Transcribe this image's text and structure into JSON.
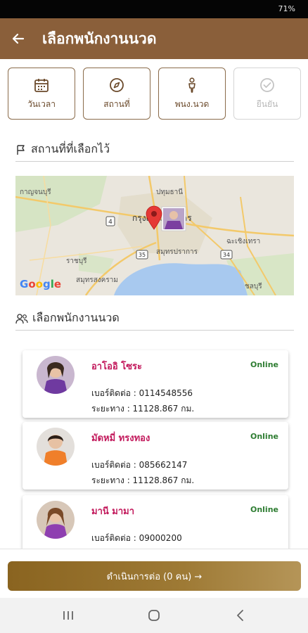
{
  "status_bar": {
    "battery": "71%"
  },
  "app_bar": {
    "title": "เลือกพนักงานนวด",
    "back_icon": "arrow-left-icon"
  },
  "steps": [
    {
      "label": "วันเวลา",
      "icon": "calendar-icon",
      "enabled": true
    },
    {
      "label": "สถานที่",
      "icon": "compass-icon",
      "enabled": true
    },
    {
      "label": "พนง.นวด",
      "icon": "person-icon",
      "enabled": true
    },
    {
      "label": "ยืนยัน",
      "icon": "check-circle-icon",
      "enabled": false
    }
  ],
  "location_section": {
    "title": "สถานที่ที่เลือกไว้",
    "icon": "flag-icon"
  },
  "map": {
    "labels": [
      "กาญจนบุรี",
      "ปทุมธานี",
      "กรุงเทพมหานคร",
      "ฉะเชิงเทรา",
      "ราชบุรี",
      "สมุทรปราการ",
      "สมุทรสงคราม",
      "ชลบุรี"
    ],
    "route_numbers": [
      "4",
      "35",
      "34"
    ],
    "provider": "Google"
  },
  "staff_section": {
    "title": "เลือกพนักงานนวด",
    "icon": "people-icon"
  },
  "staff": [
    {
      "name": "อาโออิ โซระ",
      "status": "Online",
      "phone": "เบอร์ติดต่อ : 0114548556",
      "distance": "ระยะทาง : 11128.867 กม."
    },
    {
      "name": "มัดหมี่ ทรงทอง",
      "status": "Online",
      "phone": "เบอร์ติดต่อ : 085662147",
      "distance": "ระยะทาง : 11128.867 กม."
    },
    {
      "name": "มานี มามา",
      "status": "Online",
      "phone": "เบอร์ติดต่อ : 09000200",
      "distance": ""
    }
  ],
  "continue_button": {
    "label": "ดำเนินการต่อ (0 คน) →"
  },
  "nav": {
    "recents": "recents-icon",
    "home": "home-icon",
    "back": "back-icon"
  },
  "colors": {
    "brand": "#8a5f3a",
    "online": "#2e7d32",
    "name": "#c2185b"
  }
}
